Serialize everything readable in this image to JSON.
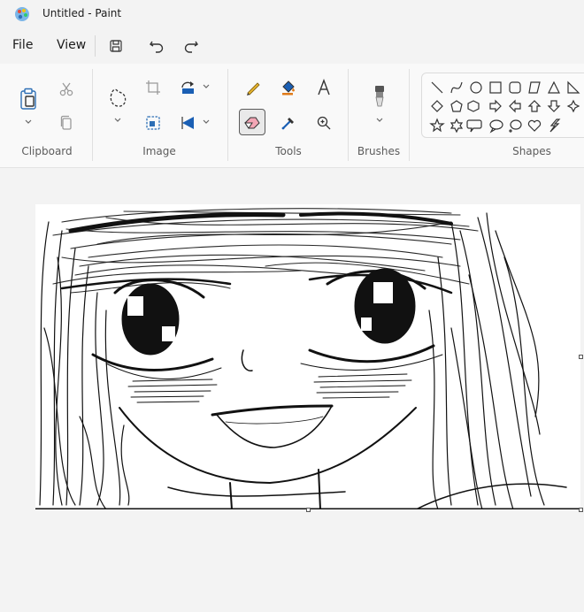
{
  "window": {
    "title": "Untitled - Paint",
    "app_icon": "paint-palette-icon"
  },
  "menu": {
    "file_label": "File",
    "view_label": "View",
    "quick_access": [
      "save-icon",
      "undo-icon",
      "redo-icon"
    ]
  },
  "ribbon": {
    "groups": {
      "clipboard": "Clipboard",
      "image": "Image",
      "tools": "Tools",
      "brushes": "Brushes",
      "shapes": "Shapes"
    },
    "clipboard_icons": [
      "paste-icon",
      "cut-icon",
      "copy-icon"
    ],
    "image_icons": [
      "free-select-icon",
      "crop-icon",
      "resize-icon",
      "rotate-icon",
      "flip-icon"
    ],
    "tools_icons": [
      "pencil-icon",
      "fill-icon",
      "text-icon",
      "eraser-icon",
      "color-picker-icon",
      "magnifier-icon"
    ],
    "selected_tool": "eraser",
    "brushes_icon": "brush-icon",
    "shapes": [
      "line",
      "curve",
      "oval",
      "rectangle",
      "rounded-rectangle",
      "polygon",
      "triangle",
      "right-triangle",
      "diamond",
      "pentagon",
      "hexagon",
      "right-arrow",
      "left-arrow",
      "up-arrow",
      "down-arrow",
      "four-point-star",
      "five-point-star",
      "six-point-star",
      "rounded-callout",
      "oval-callout",
      "cloud-callout",
      "heart",
      "lightning"
    ]
  },
  "canvas": {
    "subject": "pencil-sketch-anime-face",
    "background": "#ffffff"
  },
  "colors": {
    "accent_blue": "#1a5fb4",
    "fill_orange": "#e07b1a",
    "pencil_yellow": "#e5b32c"
  }
}
